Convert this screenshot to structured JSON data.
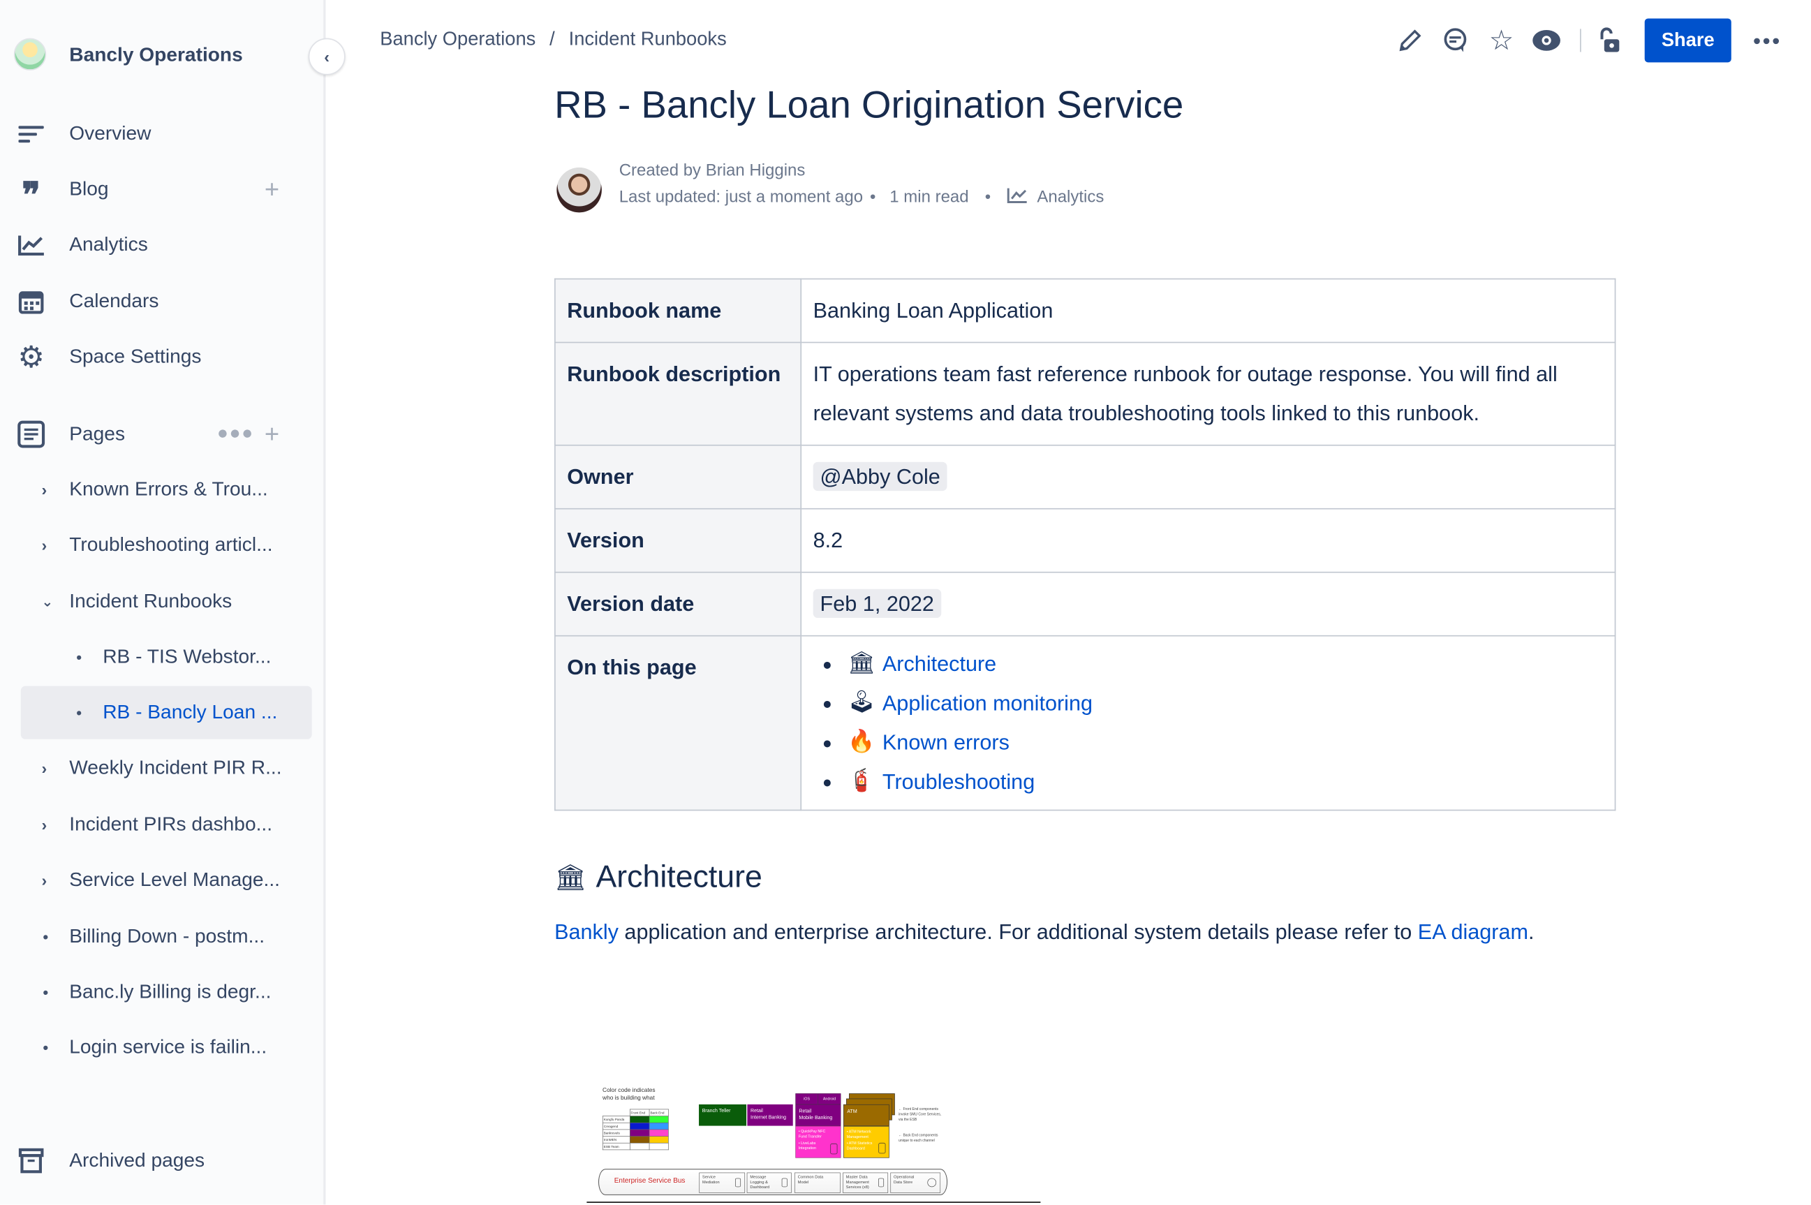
{
  "sidebar": {
    "space_name": "Bancly Operations",
    "collapse_icon": "chevron-left-icon",
    "nav": [
      {
        "label": "Overview",
        "icon": "lines-icon"
      },
      {
        "label": "Blog",
        "icon": "quote-icon"
      },
      {
        "label": "Analytics",
        "icon": "chart-icon"
      },
      {
        "label": "Calendars",
        "icon": "calendar-icon"
      },
      {
        "label": "Space Settings",
        "icon": "gear-icon"
      }
    ],
    "pages_label": "Pages",
    "tree": [
      {
        "label": "Known Errors & Trou...",
        "type": "collapsed"
      },
      {
        "label": "Troubleshooting articl...",
        "type": "collapsed"
      },
      {
        "label": "Incident Runbooks",
        "type": "expanded"
      },
      {
        "label": "RB - TIS Webstor...",
        "type": "child"
      },
      {
        "label": "RB - Bancly Loan ...",
        "type": "child",
        "selected": true
      },
      {
        "label": "Weekly Incident PIR R...",
        "type": "collapsed"
      },
      {
        "label": "Incident PIRs dashbo...",
        "type": "collapsed"
      },
      {
        "label": "Service Level Manage...",
        "type": "collapsed"
      },
      {
        "label": "Billing Down - postm...",
        "type": "leaf"
      },
      {
        "label": "Banc.ly Billing is degr...",
        "type": "leaf"
      },
      {
        "label": "Login service is failin...",
        "type": "leaf"
      }
    ],
    "archived_label": "Archived pages"
  },
  "header": {
    "breadcrumb": [
      "Bancly Operations",
      "Incident Runbooks"
    ],
    "separator": "/",
    "share_label": "Share",
    "accent": "#0052cc"
  },
  "page": {
    "title": "RB - Bancly Loan Origination Service",
    "created_by": "Created by Brian Higgins",
    "last_updated": "Last updated: just a moment ago",
    "read_time": "1 min read",
    "analytics": "Analytics",
    "table": {
      "runbook_name_label": "Runbook name",
      "runbook_name": "Banking Loan Application",
      "description_label": "Runbook description",
      "description": "IT operations team fast reference runbook for outage response. You will find all relevant systems and data troubleshooting tools linked to this runbook.",
      "owner_label": "Owner",
      "owner": "@Abby Cole",
      "version_label": "Version",
      "version": "8.2",
      "version_date_label": "Version date",
      "version_date": "Feb 1, 2022",
      "toc_label": "On this page",
      "toc": [
        {
          "emoji": "🏛",
          "label": "Architecture"
        },
        {
          "emoji": "🕹",
          "label": "Application monitoring"
        },
        {
          "emoji": "🔥",
          "label": "Known errors"
        },
        {
          "emoji": "🧯",
          "label": "Troubleshooting"
        }
      ]
    },
    "architecture": {
      "emoji": "🏛",
      "heading": "Architecture",
      "link1": "Bankly",
      "text": " application and enterprise architecture. For additional system details please refer to ",
      "link2": "EA diagram",
      "end": "."
    }
  },
  "diagram": {
    "legend_title_1": "Color code indicates",
    "legend_title_2": "who is building what",
    "legend_headers": [
      "Front End",
      "Back End"
    ],
    "legend_rows": [
      {
        "team": "Kungfu Panda",
        "front": "#0a5c0a",
        "back": "#33ff33"
      },
      {
        "team": "Creagend",
        "front": "#0a1acc",
        "back": "#3399ff"
      },
      {
        "team": "Bankrevels",
        "front": "#800080",
        "back": "#ff44cc"
      },
      {
        "team": "IronMEN",
        "front": "#8b5a00",
        "back": "#ffcc00"
      },
      {
        "team": "ESB Team",
        "front": "#ffffff",
        "back": "#ffffff"
      }
    ],
    "branch_teller": "Branch Teller",
    "retail_internet_1": "Retail",
    "retail_internet_2": "Internet Banking",
    "ios": "iOS",
    "android": "Android",
    "retail_mobile_1": "Retail",
    "retail_mobile_2": "Mobile Banking",
    "mobile_backend": [
      "• QuickPay NFC Fund Transfer",
      "• LiveLabs Integration"
    ],
    "atm": "ATM",
    "atm_backend": [
      "• ATM Network Management",
      "• ATM Statistics Dashboard"
    ],
    "note_front": "← Front End components invoke SMU Core Services, via the ESB",
    "note_back": "← Back End components unique to each channel",
    "esb": "Enterprise Service Bus",
    "esb_components": [
      "Service Mediation",
      "Message Logging & Dashboard",
      "Common Data Model",
      "Master Data Management Services (x8)",
      "Operational Data Store"
    ]
  }
}
